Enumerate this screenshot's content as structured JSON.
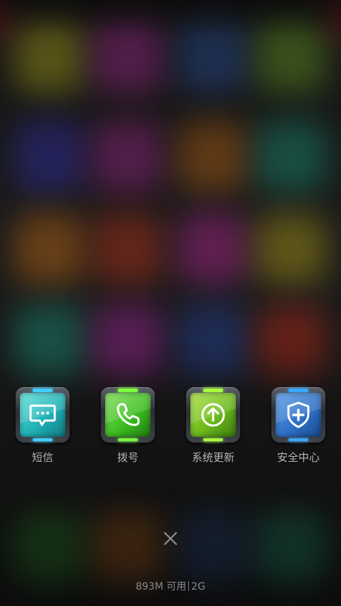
{
  "dock": {
    "apps": [
      {
        "label": "短信",
        "icon": "message-icon",
        "color": "#21b3b8"
      },
      {
        "label": "拨号",
        "icon": "phone-icon",
        "color": "#3fbf22"
      },
      {
        "label": "系统更新",
        "icon": "update-arrow-icon",
        "color": "#6dbb1c"
      },
      {
        "label": "安全中心",
        "icon": "shield-plus-icon",
        "color": "#2f72c9"
      }
    ]
  },
  "controls": {
    "close_icon": "close-icon"
  },
  "status": {
    "memory": "893M 可用",
    "network": "2G"
  },
  "colors": {
    "label": "#b9b9b9",
    "status_text": "#8a8a8a",
    "background": "#161616"
  }
}
